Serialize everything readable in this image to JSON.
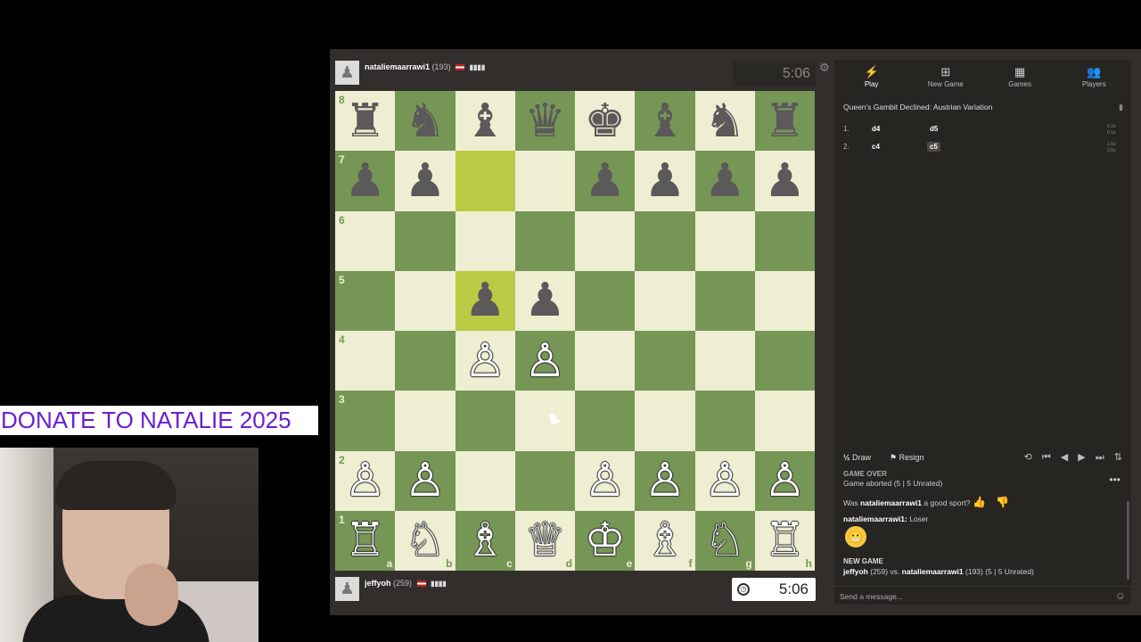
{
  "overlay": {
    "donate_text": "DONATE TO NATALIE 2025"
  },
  "top_player": {
    "name": "nataliemaarrawi1",
    "rating": "(193)",
    "signal": "▮▮▮▮",
    "clock": "5:06"
  },
  "bottom_player": {
    "name": "jeffyoh",
    "rating": "(259)",
    "signal": "▮▮▮▮",
    "clock": "5:06"
  },
  "board": {
    "ranks": [
      "8",
      "7",
      "6",
      "5",
      "4",
      "3",
      "2",
      "1"
    ],
    "files": [
      "a",
      "b",
      "c",
      "d",
      "e",
      "f",
      "g",
      "h"
    ],
    "rows": [
      [
        "♜",
        "♞",
        "♝",
        "♛",
        "♚",
        "♝",
        "♞",
        "♜"
      ],
      [
        "♟",
        "♟",
        "",
        "",
        "♟",
        "♟",
        "♟",
        "♟"
      ],
      [
        "",
        "",
        "",
        "",
        "",
        "",
        "",
        ""
      ],
      [
        "",
        "",
        "♟",
        "♟",
        "",
        "",
        "",
        ""
      ],
      [
        "",
        "",
        "♙",
        "♙",
        "",
        "",
        "",
        ""
      ],
      [
        "",
        "",
        "",
        "",
        "",
        "",
        "",
        ""
      ],
      [
        "♙",
        "♙",
        "",
        "",
        "♙",
        "♙",
        "♙",
        "♙"
      ],
      [
        "♖",
        "♘",
        "♗",
        "♕",
        "♔",
        "♗",
        "♘",
        "♖"
      ]
    ],
    "highlighted": [
      "c7",
      "c5"
    ]
  },
  "tabs": [
    {
      "label": "Play",
      "icon": "⚡"
    },
    {
      "label": "New Game",
      "icon": "⊞"
    },
    {
      "label": "Games",
      "icon": "▦"
    },
    {
      "label": "Players",
      "icon": "👥"
    }
  ],
  "opening": "Queen's Gambit Declined: Austrian Variation",
  "moves": [
    {
      "num": "1.",
      "white": "d4",
      "black": "d5",
      "t1": "0.1s",
      "t2": "0.1s"
    },
    {
      "num": "2.",
      "white": "c4",
      "black": "c5",
      "t1": "1.6s",
      "t2": "2.6s"
    }
  ],
  "actions": {
    "draw_icon": "½",
    "draw": "Draw",
    "resign": "Resign",
    "nav": "⟲ ⏮ ◀ ▶ ⏭ ⇅"
  },
  "chat": {
    "gameover": "GAME OVER",
    "aborted": "Game aborted (5 | 5 Unrated)",
    "sport_prefix": "Was ",
    "sport_name": "nataliemaarrawi1",
    "sport_suffix": " a good sport?",
    "msg_user": "nataliemaarrawi1:",
    "msg_text": " Loser",
    "newgame": "NEW GAME",
    "vs_p1": "jeffyoh",
    "vs_p1_rating": " (259) vs. ",
    "vs_p2": "nataliemaarrawi1",
    "vs_p2_rating": " (193) (5 | 5 Unrated)",
    "placeholder": "Send a message..."
  }
}
